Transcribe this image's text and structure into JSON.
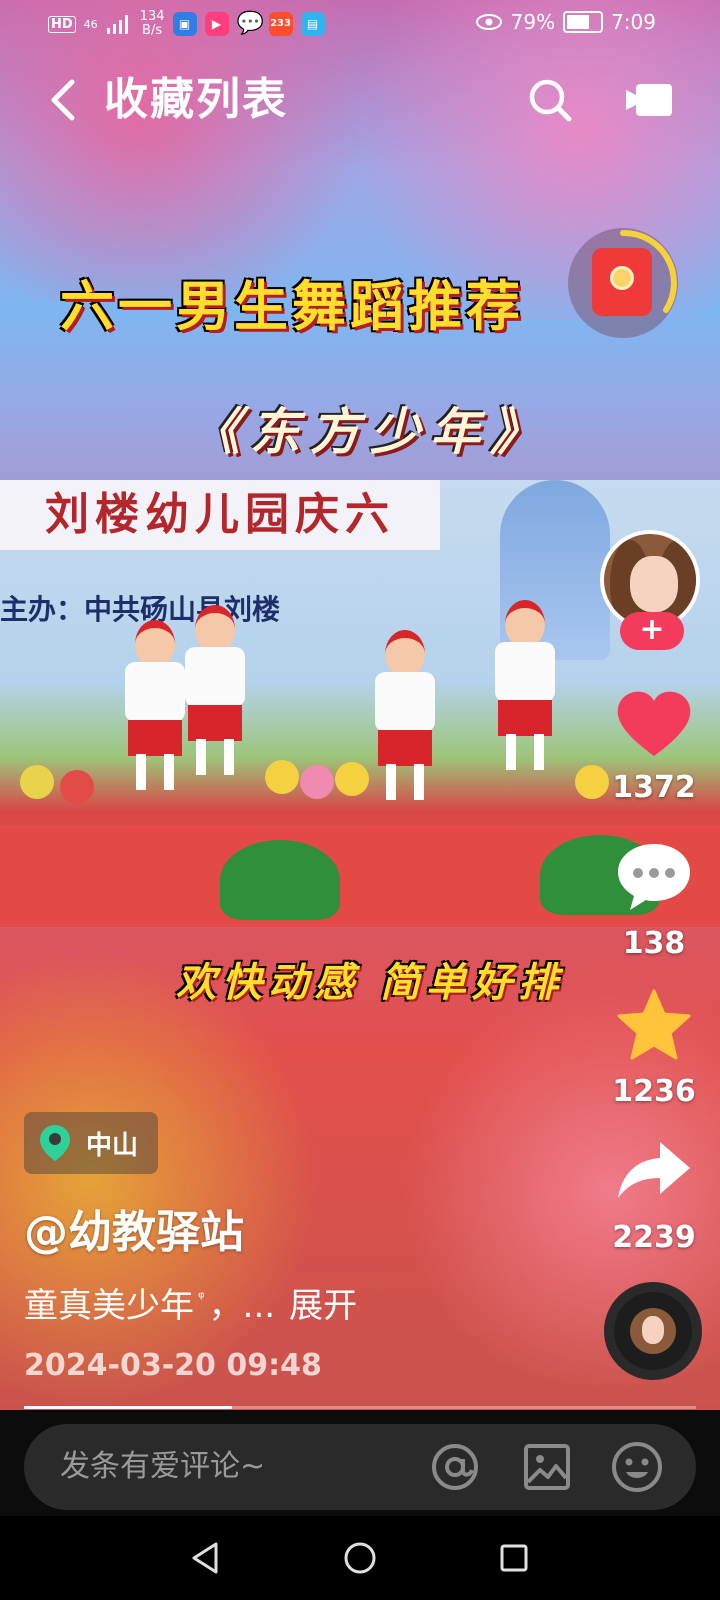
{
  "status_bar": {
    "hd": "HD",
    "signal": "46",
    "speed_value": "134",
    "speed_unit": "B/s",
    "app_badge": "233",
    "battery": "79%",
    "battery_level": 0.79,
    "time": "7:09"
  },
  "topbar": {
    "title": "收藏列表",
    "back_icon": "chevron-left-icon",
    "search_icon": "search-icon",
    "cast_icon": "video-camera-icon"
  },
  "video": {
    "title_overlay": "六一男生舞蹈推荐",
    "subtitle_overlay": "《东方少年》",
    "tag_overlay": "欢快动感  简单好排",
    "banner_text": "刘楼幼儿园庆六",
    "banner_sub": "主办：中共砀山县刘楼"
  },
  "sidebar": {
    "follow_label": "+",
    "likes": "1372",
    "comments": "138",
    "favorites": "1236",
    "shares": "2239"
  },
  "info": {
    "location": "中山",
    "author": "@幼教驿站",
    "caption": "童真美少年",
    "caption_search_marker": "ᵠ",
    "caption_tail": "，...",
    "expand_label": "展开",
    "timestamp": "2024-03-20 09:48",
    "progress": 0.31
  },
  "comment_bar": {
    "placeholder": "发条有爱评论~"
  },
  "colors": {
    "like": "#f43b5b",
    "favorite": "#ffc43a",
    "title_yellow": "#ffde2e"
  }
}
